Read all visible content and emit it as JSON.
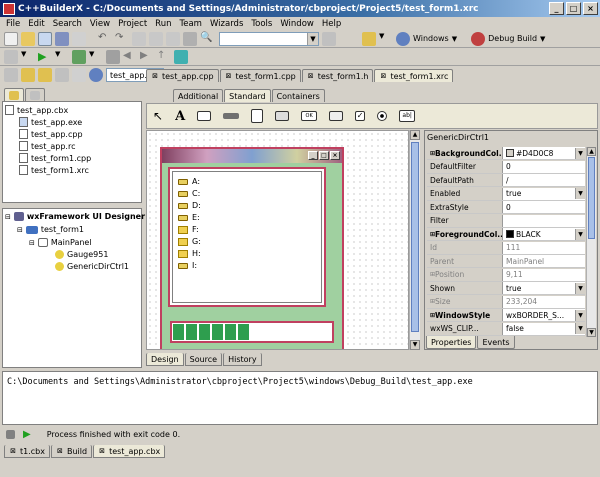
{
  "window": {
    "title": "C++BuilderX - C:/Documents and Settings/Administrator/cbproject/Project5/test_form1.xrc"
  },
  "menu": [
    "File",
    "Edit",
    "Search",
    "View",
    "Project",
    "Run",
    "Team",
    "Wizards",
    "Tools",
    "Window",
    "Help"
  ],
  "toolbar": {
    "search_value": "",
    "platform": "Windows",
    "build_config": "Debug Build"
  },
  "top_tabs": {
    "dropdown": "test_app...",
    "tabs": [
      "test_app.cpp",
      "test_form1.cpp",
      "test_form1.h",
      "test_form1.xrc"
    ]
  },
  "palette_tabs": [
    "Additional",
    "Standard",
    "Containers"
  ],
  "project_tree": {
    "root": "test_app.cbx",
    "files": [
      "test_app.exe",
      "test_app.cpp",
      "test_app.rc",
      "test_form1.cpp",
      "test_form1.xrc"
    ]
  },
  "designer_tree": {
    "title": "wxFramework UI Designer",
    "nodes": [
      "test_form1",
      "MainPanel",
      "Gauge951",
      "GenericDirCtrl1"
    ]
  },
  "form": {
    "drives": [
      "A:",
      "C:",
      "D:",
      "E:",
      "F:",
      "G:",
      "H:",
      "I:"
    ],
    "gauge_value": 0.5
  },
  "inspector": {
    "title": "GenericDirCtrl1",
    "rows": [
      {
        "key": "BackgroundCol...",
        "value": "#D4D0C8",
        "style": "bold",
        "dd": true,
        "swatch": "#d4d0c8"
      },
      {
        "key": "DefaultFilter",
        "value": "0",
        "style": ""
      },
      {
        "key": "DefaultPath",
        "value": "/",
        "style": ""
      },
      {
        "key": "Enabled",
        "value": "true",
        "style": "",
        "dd": true
      },
      {
        "key": "ExtraStyle",
        "value": "0",
        "style": ""
      },
      {
        "key": "Filter",
        "value": "",
        "style": ""
      },
      {
        "key": "ForegroundCol...",
        "value": "BLACK",
        "style": "bold",
        "dd": true,
        "swatch": "#000000"
      },
      {
        "key": "Id",
        "value": "111",
        "style": "grey"
      },
      {
        "key": "Parent",
        "value": "MainPanel",
        "style": "grey"
      },
      {
        "key": "Position",
        "value": "9,11",
        "style": "grey"
      },
      {
        "key": "Shown",
        "value": "true",
        "style": "",
        "dd": true
      },
      {
        "key": "Size",
        "value": "233,204",
        "style": "grey"
      },
      {
        "key": "WindowStyle",
        "value": "wxBORDER_S...",
        "style": "bold",
        "dd": true
      },
      {
        "key": "wxWS_CLIP...",
        "value": "false",
        "style": "",
        "dd": true
      }
    ],
    "tabs": [
      "Properties",
      "Events"
    ]
  },
  "designer_tabs": [
    "Design",
    "Source",
    "History"
  ],
  "output": {
    "command": "C:\\Documents and Settings\\Administrator\\cbproject\\Project5\\windows\\Debug_Build\\test_app.exe",
    "status": "Process finished with exit code 0."
  },
  "bottom_tabs": [
    "t1.cbx",
    "Build",
    "test_app.cbx"
  ]
}
